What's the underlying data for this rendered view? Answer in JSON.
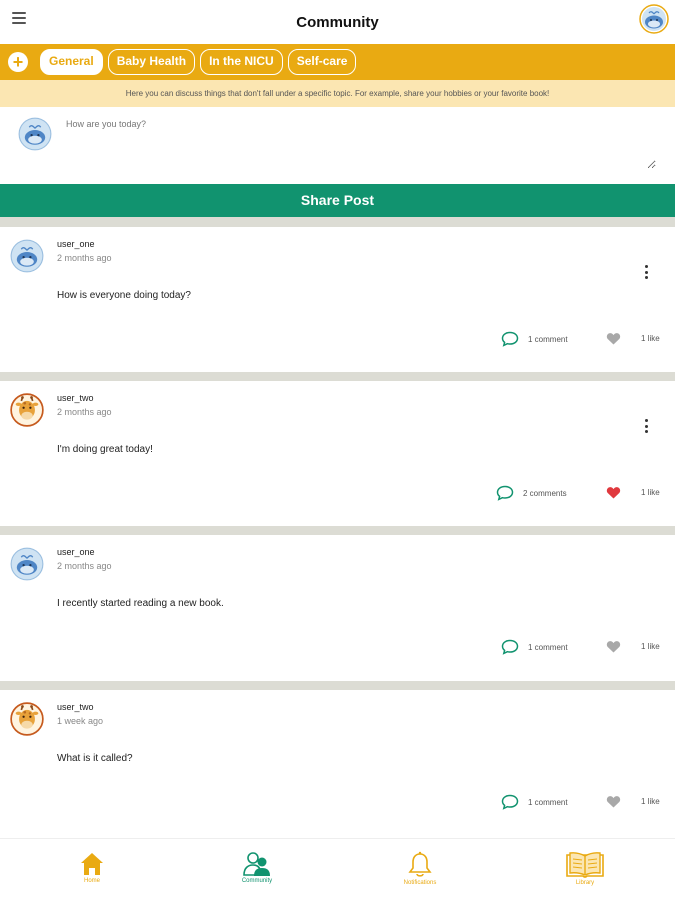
{
  "header": {
    "title": "Community"
  },
  "tabs": [
    {
      "label": "General",
      "active": true
    },
    {
      "label": "Baby Health",
      "active": false
    },
    {
      "label": "In the NICU",
      "active": false
    },
    {
      "label": "Self-care",
      "active": false
    }
  ],
  "topic_description": "Here you can discuss things that don't fall under a specific topic. For example, share your hobbies or your favorite book!",
  "compose": {
    "placeholder": "How are you today?",
    "share_label": "Share Post"
  },
  "posts": [
    {
      "username": "user_one",
      "time": "2 months ago",
      "text": "How is everyone doing today?",
      "comments": "1 comment",
      "likes": "1 like",
      "liked": false,
      "avatar": "whale"
    },
    {
      "username": "user_two",
      "time": "2 months ago",
      "text": "I'm doing great today!",
      "comments": "2 comments",
      "likes": "1 like",
      "liked": true,
      "avatar": "giraffe"
    },
    {
      "username": "user_one",
      "time": "2 months ago",
      "text": "I recently started reading a new book.",
      "comments": "1 comment",
      "likes": "1 like",
      "liked": false,
      "avatar": "whale"
    },
    {
      "username": "user_two",
      "time": "1 week ago",
      "text": "What is it called?",
      "comments": "1 comment",
      "likes": "1 like",
      "liked": false,
      "avatar": "giraffe"
    }
  ],
  "nav": [
    {
      "label": "Home",
      "icon": "home-icon",
      "color": "#e9aa12"
    },
    {
      "label": "Community",
      "icon": "community-icon",
      "color": "#11936f"
    },
    {
      "label": "Notifications",
      "icon": "bell-icon",
      "color": "#e9aa12"
    },
    {
      "label": "Library",
      "icon": "book-icon",
      "color": "#e9aa12"
    }
  ],
  "colors": {
    "brand_yellow": "#e9aa12",
    "brand_green": "#11936f",
    "liked_red": "#e0393e",
    "unliked_gray": "#a8a8a8"
  }
}
